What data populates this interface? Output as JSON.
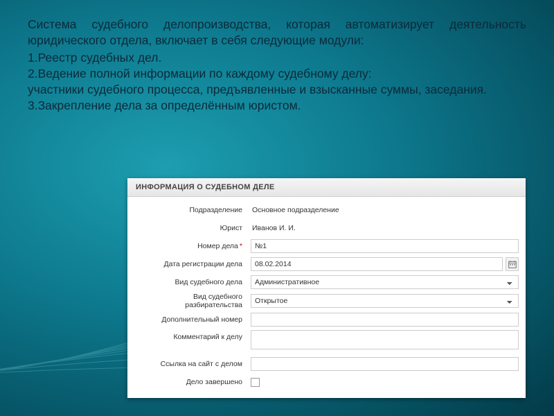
{
  "intro": {
    "para1": "Система судебного делопроизводства, которая автоматизирует деятельность юридического отдела,  включает в себя следующие модули:",
    "item1": "1.Реестр судебных дел.",
    "item2": "2.Ведение полной информации по каждому судебному делу:",
    "item2b": "участники судебного процесса, предъявленные и взысканные суммы, заседания.",
    "item3": "3.Закрепление дела за определённым юристом."
  },
  "form": {
    "header": "ИНФОРМАЦИЯ О СУДЕБНОМ ДЕЛЕ",
    "labels": {
      "division": "Подразделение",
      "lawyer": "Юрист",
      "case_no": "Номер дела",
      "reg_date": "Дата регистрации дела",
      "case_type": "Вид судебного дела",
      "proc_type": "Вид судебного разбирательства",
      "extra_no": "Дополнительный номер",
      "comment": "Комментарий к делу",
      "link": "Ссылка на сайт с делом",
      "closed": "Дело завершено"
    },
    "values": {
      "division": "Основное подразделение",
      "lawyer": "Иванов И. И.",
      "case_no": "№1",
      "reg_date": "08.02.2014",
      "case_type": "Административное",
      "proc_type": "Открытое",
      "extra_no": "",
      "comment": "",
      "link": ""
    }
  }
}
